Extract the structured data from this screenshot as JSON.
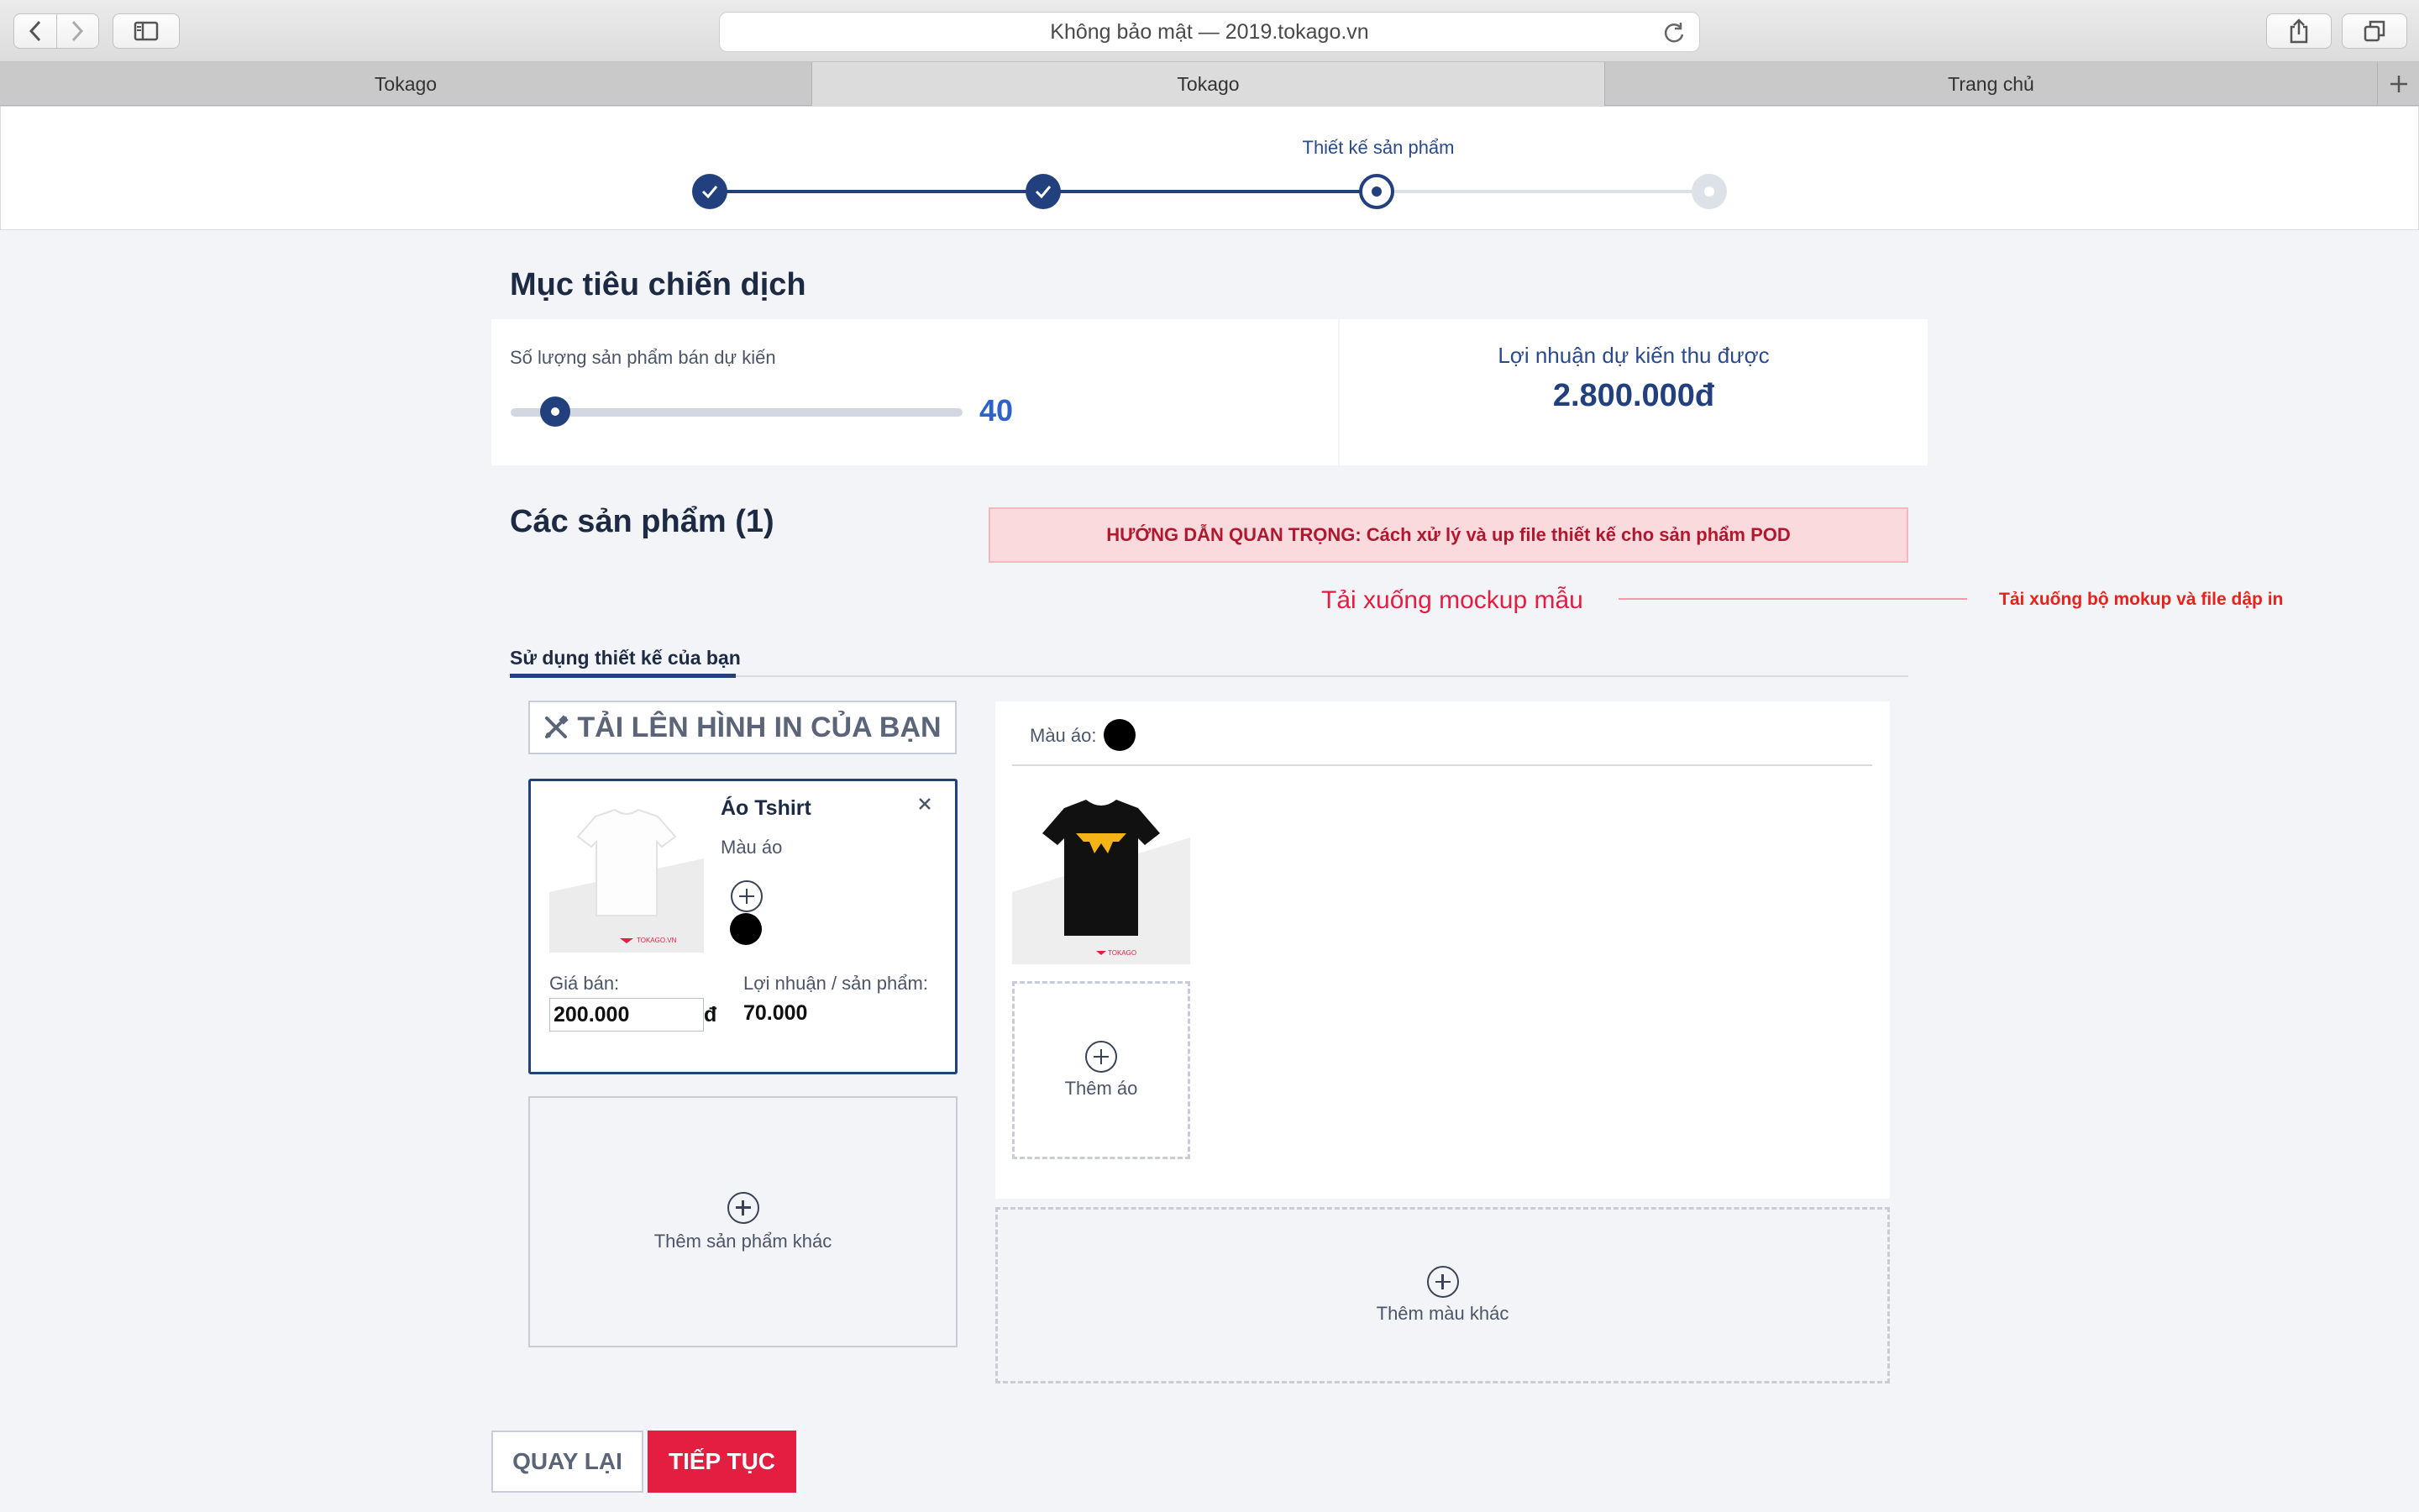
{
  "browser": {
    "address": "Không bảo mật — 2019.tokago.vn",
    "tabs": [
      {
        "title": "Tokago",
        "active": false
      },
      {
        "title": "Tokago",
        "active": true
      },
      {
        "title": "Trang chủ",
        "active": false
      }
    ]
  },
  "steps": {
    "current_label": "Thiết kế sản phẩm",
    "states": [
      "done",
      "done",
      "current",
      "pending"
    ]
  },
  "goal": {
    "title": "Mục tiêu chiến dịch",
    "quantity_label": "Số lượng sản phẩm bán dự kiến",
    "quantity_value": "40",
    "profit_label": "Lợi nhuận dự kiến thu được",
    "profit_value": "2.800.000đ"
  },
  "products": {
    "title": "Các sản phẩm (1)",
    "guide_banner": "HƯỚNG DẪN QUAN TRỌNG: Cách xử lý và up file thiết kế cho sản phẩm POD",
    "download_link": "Tải xuống mockup mẫu",
    "annotation": "Tải xuống bộ mokup và file dập in",
    "design_tab": "Sử dụng thiết kế của bạn",
    "upload_button": "TẢI LÊN HÌNH IN CỦA BẠN",
    "item": {
      "name": "Áo Tshirt",
      "color_label": "Màu áo",
      "price_label": "Giá bán:",
      "price_value": "200.000",
      "currency": "đ",
      "profit_label": "Lợi nhuận / sản phẩm:",
      "profit_value": "70.000",
      "thumb_brand": "TOKAGO.VN"
    },
    "add_product": "Thêm sản phẩm khác",
    "color_picker_label": "Màu áo:",
    "mockup_brand": "TOKAGO",
    "add_shirt": "Thêm áo",
    "add_color": "Thêm màu khác"
  },
  "actions": {
    "back": "QUAY LẠI",
    "next": "TIẾP TỤC"
  },
  "colors": {
    "primary": "#23407e",
    "accent_red": "#e31e41",
    "banner_bg": "#fadadd"
  }
}
